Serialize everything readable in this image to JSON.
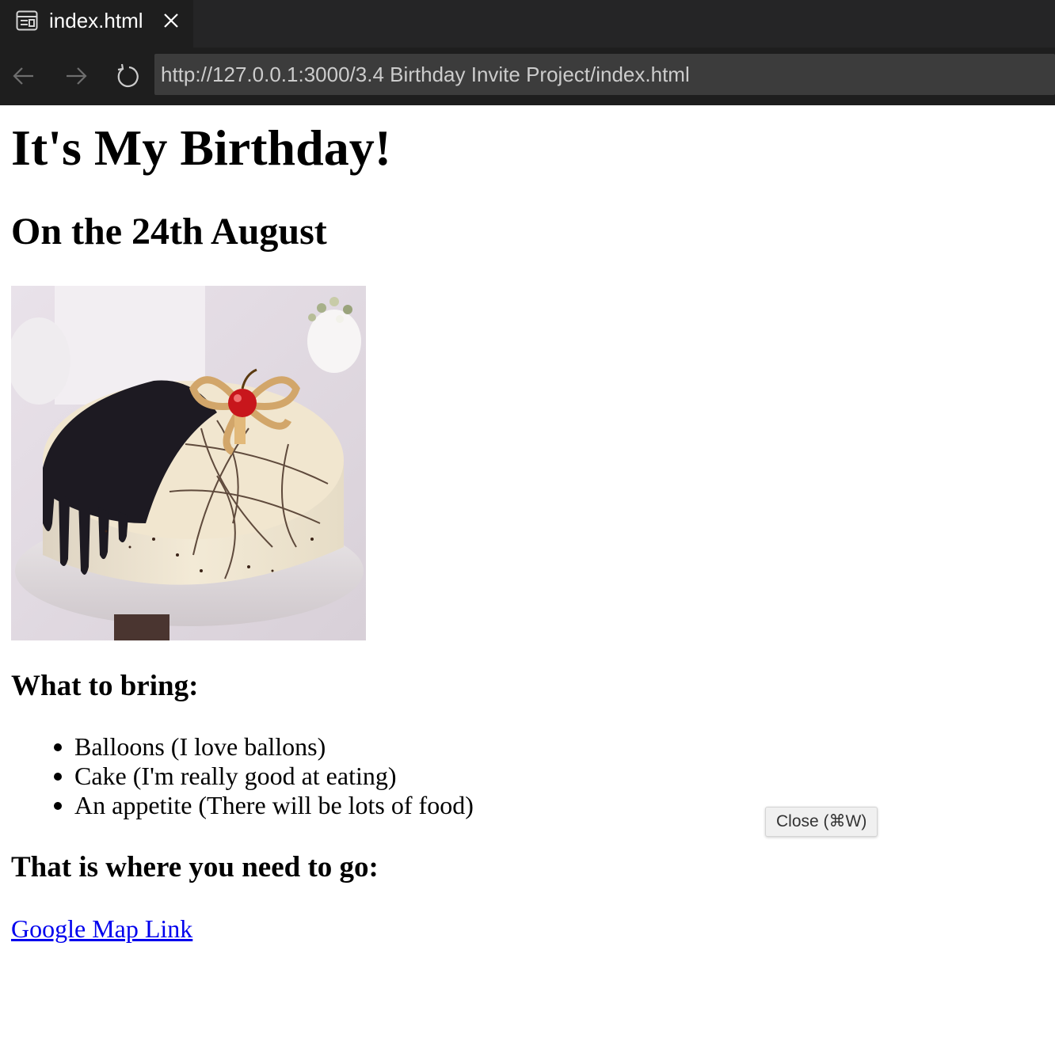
{
  "browser": {
    "tab": {
      "title": "index.html",
      "icon": "preview-icon",
      "close_icon": "close-icon"
    },
    "nav": {
      "back_icon": "arrow-left-icon",
      "forward_icon": "arrow-right-icon",
      "reload_icon": "reload-icon"
    },
    "url": "http://127.0.0.1:3000/3.4 Birthday Invite Project/index.html",
    "colors": {
      "tabbar_bg": "#252526",
      "toolbar_bg": "#1e1e1e",
      "url_bg": "#3c3c3c",
      "url_text": "#cccccc"
    }
  },
  "page": {
    "title": "It's My Birthday!",
    "date_heading": "On the 24th August",
    "image": {
      "subject": "chocolate and vanilla cake with cherry on cake stand"
    },
    "bring_heading": "What to bring:",
    "bring_items": [
      "Balloons (I love ballons)",
      "Cake (I'm really good at eating)",
      "An appetite (There will be lots of food)"
    ],
    "location_heading": "That is where you need to go:",
    "map_link": "Google Map Link",
    "link_color": "#0000ee"
  },
  "tooltip": {
    "text": "Close (⌘W)"
  }
}
